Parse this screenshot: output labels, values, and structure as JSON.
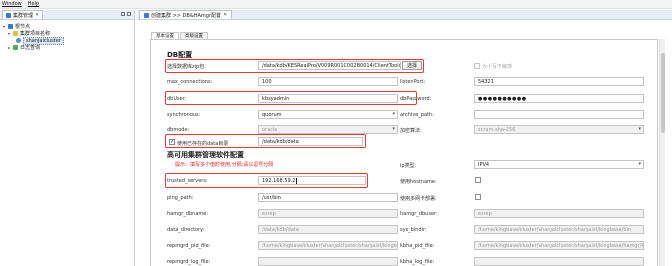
{
  "menu": {
    "items": [
      "Window",
      "Help"
    ]
  },
  "left_panel": {
    "tab_title": "集群管理",
    "tree": [
      {
        "label": "根节点",
        "level": 0,
        "expanded": true,
        "icon": "root-icon"
      },
      {
        "label": "集群项目名称",
        "level": 1,
        "expanded": true,
        "icon": "folder-icon"
      },
      {
        "label": "shanjaicluster",
        "level": 2,
        "selected": true,
        "icon": "cluster-icon"
      },
      {
        "label": "日志查询",
        "level": 1,
        "expanded": false,
        "icon": "log-icon"
      }
    ]
  },
  "editor": {
    "tab_title": "创建集群 >> DB&HAmgr配置",
    "sub_tabs": [
      "基本设置",
      "高级设置"
    ]
  },
  "form": {
    "db_section_title": "DB配置",
    "install_pkg": {
      "label": "选择数据库zip包:",
      "value": "/data/kdb/KESRealPro/V009R001C002B0014/ClientTools/gui",
      "button": "选择"
    },
    "case_insensitive": {
      "label": "大小写不敏感",
      "checked": false
    },
    "max_connections": {
      "label": "max_connections:",
      "value": "100"
    },
    "listen_port": {
      "label": "listenPort:",
      "value": "54321"
    },
    "db_user": {
      "label": "dbUser:",
      "value": "kbsyadmin"
    },
    "db_password": {
      "label": "dbPassword:",
      "value": "●●●●●●●●●●"
    },
    "synchronous": {
      "label": "synchronous:",
      "value": "quorum"
    },
    "archive_path": {
      "label": "archive_path:",
      "value": ""
    },
    "dbmode": {
      "label": "dbmode:",
      "value": "oracle"
    },
    "encryption": {
      "label": "加密算法:",
      "value": "scram-sha-256"
    },
    "use_existing_data": {
      "label": "使用已存在的data目录",
      "checked": true,
      "value": "/data/kdb/data"
    },
    "ha_section_title": "高可用集群管理软件配置",
    "hint": "提示：填写多个值时使用,分隔;请以逗号分隔",
    "ip_type": {
      "label": "ip类型:",
      "value": "IPV4"
    },
    "trusted_servers": {
      "label": "trusted_servers:",
      "value": "192.168.59.2"
    },
    "use_hostname": {
      "label": "使用hostname:",
      "checked": false
    },
    "ping_path": {
      "label": "ping_path:",
      "value": "/usr/bin"
    },
    "use_multi_nic": {
      "label": "使用多网卡部署:",
      "checked": false
    },
    "hamgr_dbname": {
      "label": "hamgr_dbname:",
      "value": "esrep"
    },
    "hamgr_dbuser": {
      "label": "hamgr_dbuser:",
      "value": "esrep"
    },
    "data_directory": {
      "label": "data_directory:",
      "value": "/data/kdb/data"
    },
    "sys_bindir": {
      "label": "sys_bindir:",
      "value": "/home/kingbase/cluster/shanjaicluster/shanjaist/kingbase/bin"
    },
    "repmgrd_pid_file": {
      "label": "repmgrd_pid_file:",
      "value": "/home/kingbase/cluster/shanjaicluster/shanjaist/kingbase/hamgr/..."
    },
    "kbha_pid_file": {
      "label": "kbha_pid_file:",
      "value": "/home/kingbase/cluster/shanjaicluster/shanjaist/kingbase/hamgr/kbha.pid"
    },
    "repmgrd_log_file": {
      "label": "repmgrd_log_file:",
      "value": ""
    },
    "kbha_log_file": {
      "label": "kbha_log_file:",
      "value": ""
    }
  }
}
